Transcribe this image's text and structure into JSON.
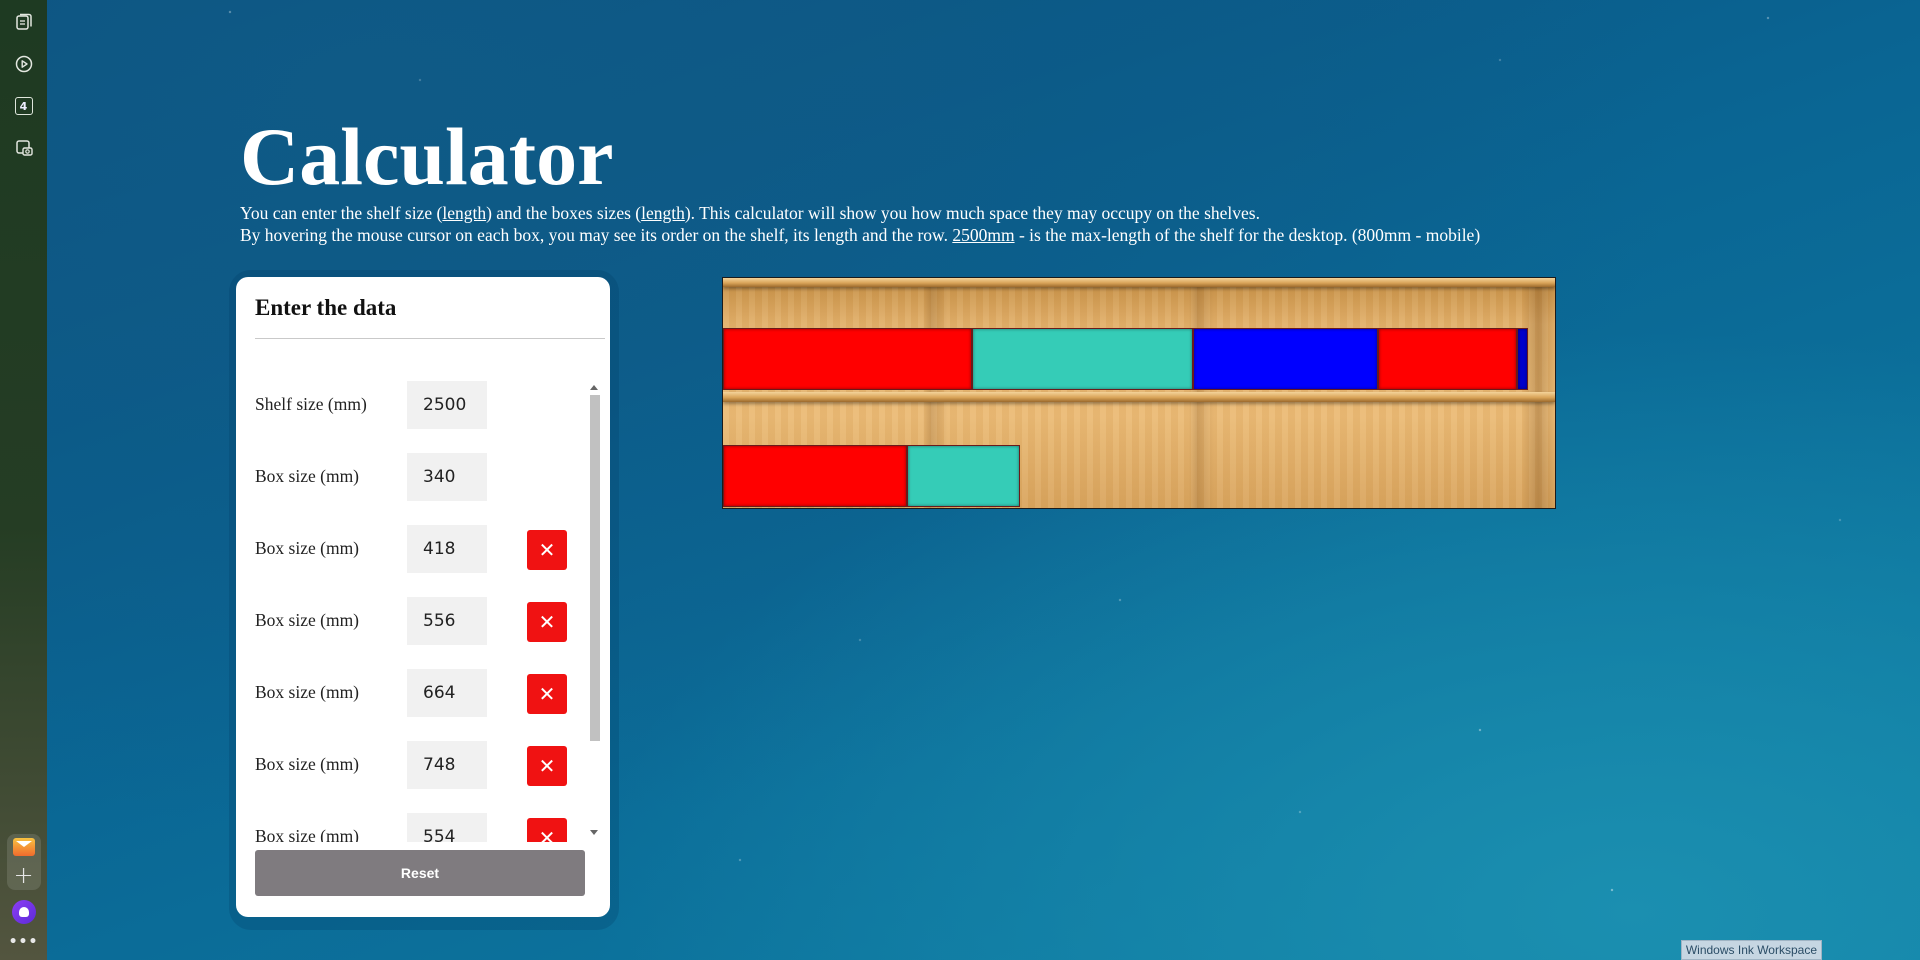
{
  "page": {
    "title": "Calculator",
    "description": {
      "line1": {
        "p1": "You can enter the shelf size (",
        "link1": "length",
        "p2": ") and the boxes sizes (",
        "link2": "length",
        "p3": "). This calculator will show you how much space they may occupy on the shelves."
      },
      "line2": {
        "p1": "By hovering the mouse cursor on each box, you may see its order on the shelf, its length and the row. ",
        "link": "2500mm",
        "p2": " - is the max-length of the shelf for the desktop. (800mm - mobile)"
      }
    }
  },
  "sidebar": {
    "badge": "4",
    "icons": [
      "notes-icon",
      "play-icon",
      "badge-icon",
      "camera-icon",
      "mail-app-icon",
      "plus-icon",
      "assistant-icon",
      "more-icon"
    ]
  },
  "form": {
    "title": "Enter the data",
    "shelf": {
      "label": "Shelf size (mm)",
      "value": "2500"
    },
    "boxes": [
      {
        "label": "Box size (mm)",
        "value": "340",
        "removable": false
      },
      {
        "label": "Box size (mm)",
        "value": "418",
        "removable": true
      },
      {
        "label": "Box size (mm)",
        "value": "556",
        "removable": true
      },
      {
        "label": "Box size (mm)",
        "value": "664",
        "removable": true
      },
      {
        "label": "Box size (mm)",
        "value": "748",
        "removable": true
      },
      {
        "label": "Box size (mm)",
        "value": "554",
        "removable": true
      }
    ],
    "remove_symbol": "✕",
    "reset_label": "Reset",
    "scroll_position": 0
  },
  "shelf_view": {
    "colors": {
      "red": "#ff0000",
      "teal": "#35ccb7",
      "blue": "#0000ff"
    },
    "rows": [
      [
        {
          "color": "#ff0000",
          "length": 748
        },
        {
          "color": "#35ccb7",
          "length": 664
        },
        {
          "color": "#0000ff",
          "length": 556
        },
        {
          "color": "#ff0000",
          "length": 418
        },
        {
          "color": "#0000cc",
          "length": 34
        }
      ],
      [
        {
          "color": "#ff0000",
          "length": 554
        },
        {
          "color": "#35ccb7",
          "length": 340
        }
      ]
    ]
  },
  "taskbar": {
    "ink_label": "Windows Ink Workspace"
  }
}
